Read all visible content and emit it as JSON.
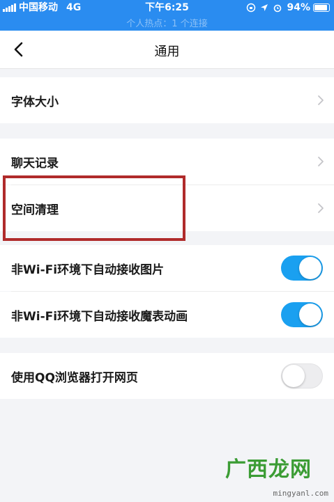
{
  "status_bar": {
    "carrier": "中国移动",
    "network": "4G",
    "time": "下午6:25",
    "battery": "94%",
    "hotspot_text": "个人热点：1 个连接"
  },
  "nav": {
    "title": "通用",
    "back_icon": "chevron-left-icon"
  },
  "settings": {
    "font_size": "字体大小",
    "chat_history": "聊天记录",
    "space_cleanup": "空间清理",
    "auto_receive_images": {
      "label": "非Wi-Fi环境下自动接收图片",
      "on": true
    },
    "auto_receive_animations": {
      "label": "非Wi-Fi环境下自动接收魔表动画",
      "on": true
    },
    "qq_browser": {
      "label": "使用QQ浏览器打开网页",
      "on": false
    }
  },
  "colors": {
    "status_bar": "#2a8cf0",
    "toggle_on": "#1aa0f0",
    "highlight_box": "#b02b2b"
  },
  "watermark": {
    "brand": "广西龙网",
    "url": "mingyanl.com"
  }
}
